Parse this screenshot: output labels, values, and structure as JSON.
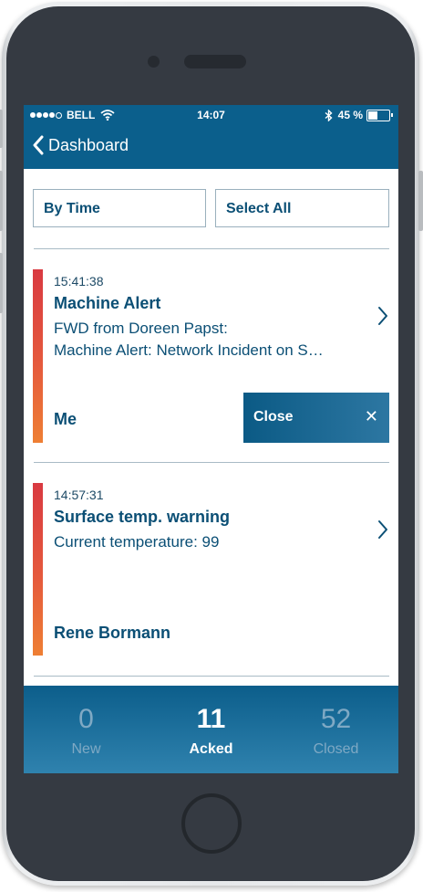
{
  "status_bar": {
    "carrier": "BELL",
    "time": "14:07",
    "battery": "45 %",
    "battery_level": 0.45
  },
  "nav": {
    "back_label": "Dashboard"
  },
  "filters": {
    "sort_label": "By Time",
    "select_label": "Select All"
  },
  "alerts": [
    {
      "time": "15:41:38",
      "title": "Machine Alert",
      "desc_line1": "FWD from Doreen Papst:",
      "desc_line2": "Machine Alert: Network Incident on S…",
      "owner": "Me",
      "close_label": "Close"
    },
    {
      "time": "14:57:31",
      "title": "Surface temp. warning",
      "desc_line1": "Current temperature: 99",
      "owner": "Rene Bormann"
    }
  ],
  "tabs": [
    {
      "count": "0",
      "label": "New"
    },
    {
      "count": "11",
      "label": "Acked",
      "active": true
    },
    {
      "count": "52",
      "label": "Closed"
    }
  ],
  "colors": {
    "brand_blue": "#0b5f8c",
    "text_blue": "#0b4f75",
    "alert_red": "#d93a41",
    "alert_orange": "#ee7f34"
  }
}
